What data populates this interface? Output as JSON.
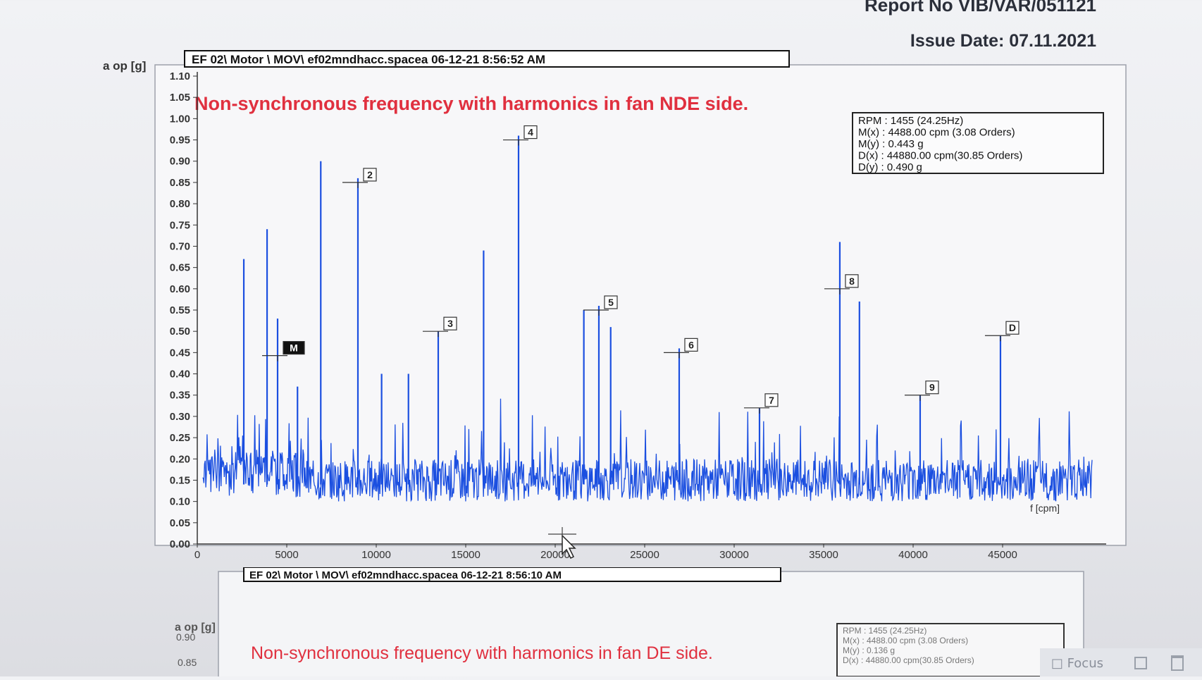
{
  "report": {
    "report_no": "Report No VIB/VAR/051121",
    "issue_date": "Issue Date: 07.11.2021"
  },
  "chart_data": [
    {
      "type": "line",
      "title": "Non-synchronous frequency with harmonics in fan NDE side.",
      "file_label": "EF 02\\ Motor \\ MOV\\ ef02mndhacc.spacea 06-12-21 8:56:52 AM",
      "ylabel": "a op [g]",
      "xlabel": "f [cpm]",
      "ylim": [
        0,
        1.1
      ],
      "xlim": [
        0,
        50000
      ],
      "y_ticks": [
        "0.00",
        "0.05",
        "0.10",
        "0.15",
        "0.20",
        "0.25",
        "0.30",
        "0.35",
        "0.40",
        "0.45",
        "0.50",
        "0.55",
        "0.60",
        "0.65",
        "0.70",
        "0.75",
        "0.80",
        "0.85",
        "0.90",
        "0.95",
        "1.00",
        "1.05",
        "1.10"
      ],
      "x_ticks": [
        "0",
        "5000",
        "10000",
        "15000",
        "20000",
        "25000",
        "30000",
        "35000",
        "40000",
        "45000"
      ],
      "grid": false,
      "info_box": [
        "RPM : 1455 (24.25Hz)",
        "M(x) : 4488.00 cpm (3.08 Orders)",
        "M(y) : 0.443 g",
        "D(x) : 44880.00 cpm(30.85 Orders)",
        "D(y) : 0.490 g"
      ],
      "markers": [
        {
          "label": "M",
          "x": 4488,
          "y": 0.443
        },
        {
          "label": "2",
          "x": 8976,
          "y": 0.85
        },
        {
          "label": "3",
          "x": 13464,
          "y": 0.5
        },
        {
          "label": "4",
          "x": 17952,
          "y": 0.95
        },
        {
          "label": "5",
          "x": 22440,
          "y": 0.55
        },
        {
          "label": "6",
          "x": 26928,
          "y": 0.45
        },
        {
          "label": "7",
          "x": 31416,
          "y": 0.32
        },
        {
          "label": "8",
          "x": 35904,
          "y": 0.6
        },
        {
          "label": "9",
          "x": 40392,
          "y": 0.35
        },
        {
          "label": "D",
          "x": 44880,
          "y": 0.49
        }
      ],
      "peaks": [
        {
          "x": 2600,
          "y": 0.67
        },
        {
          "x": 3900,
          "y": 0.74
        },
        {
          "x": 4488,
          "y": 0.53
        },
        {
          "x": 5600,
          "y": 0.37
        },
        {
          "x": 6900,
          "y": 0.9
        },
        {
          "x": 8976,
          "y": 0.86
        },
        {
          "x": 10300,
          "y": 0.4
        },
        {
          "x": 11800,
          "y": 0.4
        },
        {
          "x": 13464,
          "y": 0.5
        },
        {
          "x": 16000,
          "y": 0.69
        },
        {
          "x": 17952,
          "y": 0.96
        },
        {
          "x": 21600,
          "y": 0.55
        },
        {
          "x": 22440,
          "y": 0.56
        },
        {
          "x": 23100,
          "y": 0.51
        },
        {
          "x": 26928,
          "y": 0.46
        },
        {
          "x": 31416,
          "y": 0.32
        },
        {
          "x": 35904,
          "y": 0.71
        },
        {
          "x": 37000,
          "y": 0.57
        },
        {
          "x": 40392,
          "y": 0.35
        },
        {
          "x": 44880,
          "y": 0.49
        }
      ]
    },
    {
      "type": "line",
      "title": "Non-synchronous frequency with harmonics in fan DE side.",
      "file_label": "EF 02\\ Motor \\ MOV\\ ef02mndhacc.spacea 06-12-21 8:56:10 AM",
      "ylabel": "a op [g]",
      "y_ticks": [
        "0.90",
        "0.85"
      ],
      "info_box": [
        "RPM : 1455 (24.25Hz)",
        "M(x) : 4488.00 cpm (3.08 Orders)",
        "M(y) : 0.136 g",
        "D(x) : 44880.00 cpm(30.85 Orders)"
      ]
    }
  ],
  "status": {
    "focus_label": "Focus"
  }
}
